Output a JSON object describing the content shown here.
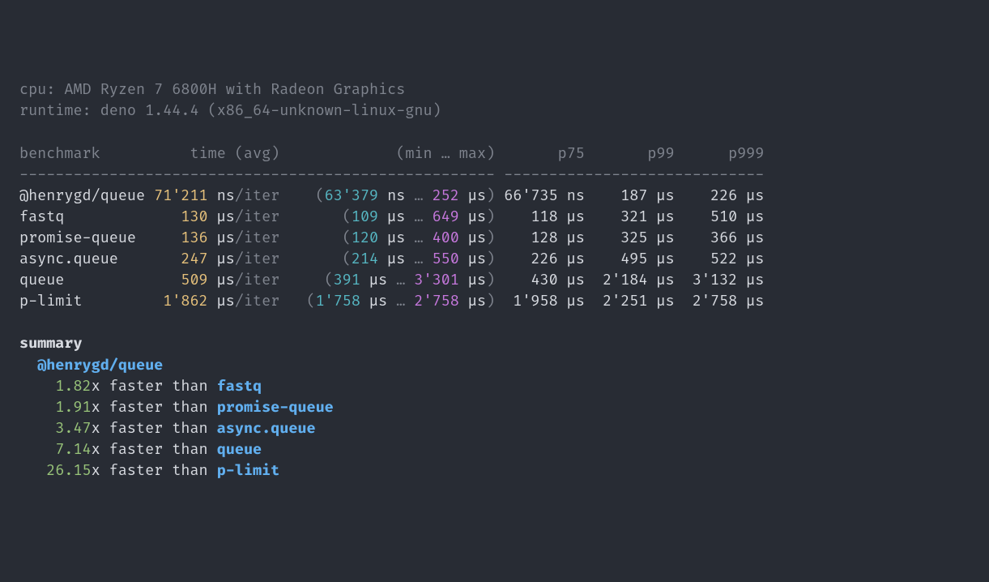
{
  "header": {
    "cpu_label": "cpu: ",
    "cpu_value": "AMD Ryzen 7 6800H with Radeon Graphics",
    "runtime_label": "runtime: ",
    "runtime_value": "deno 1.44.4 (x86_64-unknown-linux-gnu)"
  },
  "columns": {
    "benchmark": "benchmark",
    "time": "time (avg)",
    "minmax": "(min … max)",
    "p75": "p75",
    "p99": "p99",
    "p999": "p999"
  },
  "divider1": "---------------------------------------------------------",
  "divider2": "-----------------------------",
  "rows": [
    {
      "name": "@henrygd/queue",
      "time_val": "71'211",
      "time_unit": "ns",
      "iter": "/iter",
      "min_val": "63'379",
      "min_unit": "ns",
      "max_val": "252",
      "max_unit": "µs",
      "p75_val": "66'735",
      "p75_unit": "ns",
      "p99_val": "187",
      "p99_unit": "µs",
      "p999_val": "226",
      "p999_unit": "µs"
    },
    {
      "name": "fastq",
      "time_val": "130",
      "time_unit": "µs",
      "iter": "/iter",
      "min_val": "109",
      "min_unit": "µs",
      "max_val": "649",
      "max_unit": "µs",
      "p75_val": "118",
      "p75_unit": "µs",
      "p99_val": "321",
      "p99_unit": "µs",
      "p999_val": "510",
      "p999_unit": "µs"
    },
    {
      "name": "promise-queue",
      "time_val": "136",
      "time_unit": "µs",
      "iter": "/iter",
      "min_val": "120",
      "min_unit": "µs",
      "max_val": "400",
      "max_unit": "µs",
      "p75_val": "128",
      "p75_unit": "µs",
      "p99_val": "325",
      "p99_unit": "µs",
      "p999_val": "366",
      "p999_unit": "µs"
    },
    {
      "name": "async.queue",
      "time_val": "247",
      "time_unit": "µs",
      "iter": "/iter",
      "min_val": "214",
      "min_unit": "µs",
      "max_val": "550",
      "max_unit": "µs",
      "p75_val": "226",
      "p75_unit": "µs",
      "p99_val": "495",
      "p99_unit": "µs",
      "p999_val": "522",
      "p999_unit": "µs"
    },
    {
      "name": "queue",
      "time_val": "509",
      "time_unit": "µs",
      "iter": "/iter",
      "min_val": "391",
      "min_unit": "µs",
      "max_val": "3'301",
      "max_unit": "µs",
      "p75_val": "430",
      "p75_unit": "µs",
      "p99_val": "2'184",
      "p99_unit": "µs",
      "p999_val": "3'132",
      "p999_unit": "µs"
    },
    {
      "name": "p-limit",
      "time_val": "1'862",
      "time_unit": "µs",
      "iter": "/iter",
      "min_val": "1'758",
      "min_unit": "µs",
      "max_val": "2'758",
      "max_unit": "µs",
      "p75_val": "1'958",
      "p75_unit": "µs",
      "p99_val": "2'251",
      "p99_unit": "µs",
      "p999_val": "2'758",
      "p999_unit": "µs"
    }
  ],
  "summary": {
    "title": "summary",
    "winner": "@henrygd/queue",
    "faster_than": " faster than ",
    "lines": [
      {
        "factor": "1.82",
        "x": "x",
        "target": "fastq"
      },
      {
        "factor": "1.91",
        "x": "x",
        "target": "promise-queue"
      },
      {
        "factor": "3.47",
        "x": "x",
        "target": "async.queue"
      },
      {
        "factor": "7.14",
        "x": "x",
        "target": "queue"
      },
      {
        "factor": "26.15",
        "x": "x",
        "target": "p-limit"
      }
    ]
  },
  "glue": {
    "ellipsis": " … ",
    "lp": "(",
    "rp": ")",
    "sp": " "
  }
}
